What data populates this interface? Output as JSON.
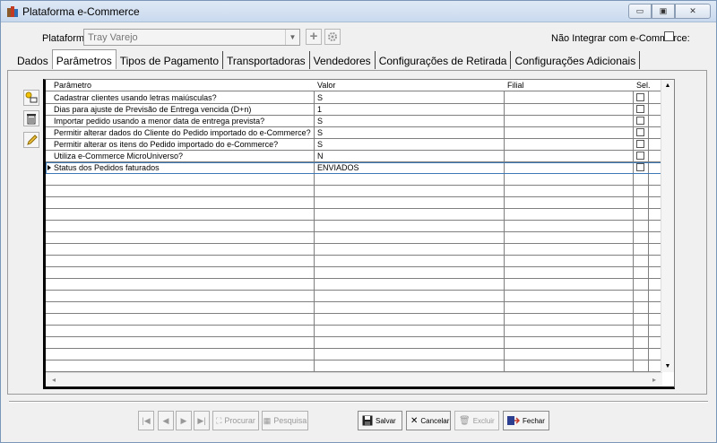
{
  "window": {
    "title": "Plataforma e-Commerce",
    "minimize": "▭",
    "maximize": "▣",
    "close": "✕"
  },
  "top": {
    "plataforma_label": "Plataforma:",
    "plataforma_value": "Tray Varejo",
    "nao_integrar_label": "Não Integrar com e-Commerce:"
  },
  "tabs": [
    "Dados",
    "Parâmetros",
    "Tipos de Pagamento",
    "Transportadoras",
    "Vendedores",
    "Configurações de Retirada",
    "Configurações Adicionais"
  ],
  "grid": {
    "headers": {
      "parametro": "Parâmetro",
      "valor": "Valor",
      "filial": "Filial",
      "sel": "Sel."
    },
    "rows": [
      {
        "parametro": "Cadastrar clientes usando letras maiúsculas?",
        "valor": "S",
        "filial": ""
      },
      {
        "parametro": "Dias para ajuste de Previsão de Entrega vencida (D+n)",
        "valor": "1",
        "filial": ""
      },
      {
        "parametro": "Importar pedido usando a menor data de entrega prevista?",
        "valor": "S",
        "filial": ""
      },
      {
        "parametro": "Permitir alterar dados do Cliente do Pedido importado do e-Commerce?",
        "valor": "S",
        "filial": ""
      },
      {
        "parametro": "Permitir alterar os itens do Pedido importado do e-Commerce?",
        "valor": "S",
        "filial": ""
      },
      {
        "parametro": "Utiliza e-Commerce MicroUniverso?",
        "valor": "N",
        "filial": ""
      },
      {
        "parametro": "Status dos Pedidos faturados",
        "valor": "ENVIADOS",
        "filial": ""
      }
    ]
  },
  "bottom": {
    "procurar": "Procurar",
    "pesquisa": "Pesquisa",
    "salvar": "Salvar",
    "cancelar": "Cancelar",
    "excluir": "Excluir",
    "fechar": "Fechar"
  }
}
